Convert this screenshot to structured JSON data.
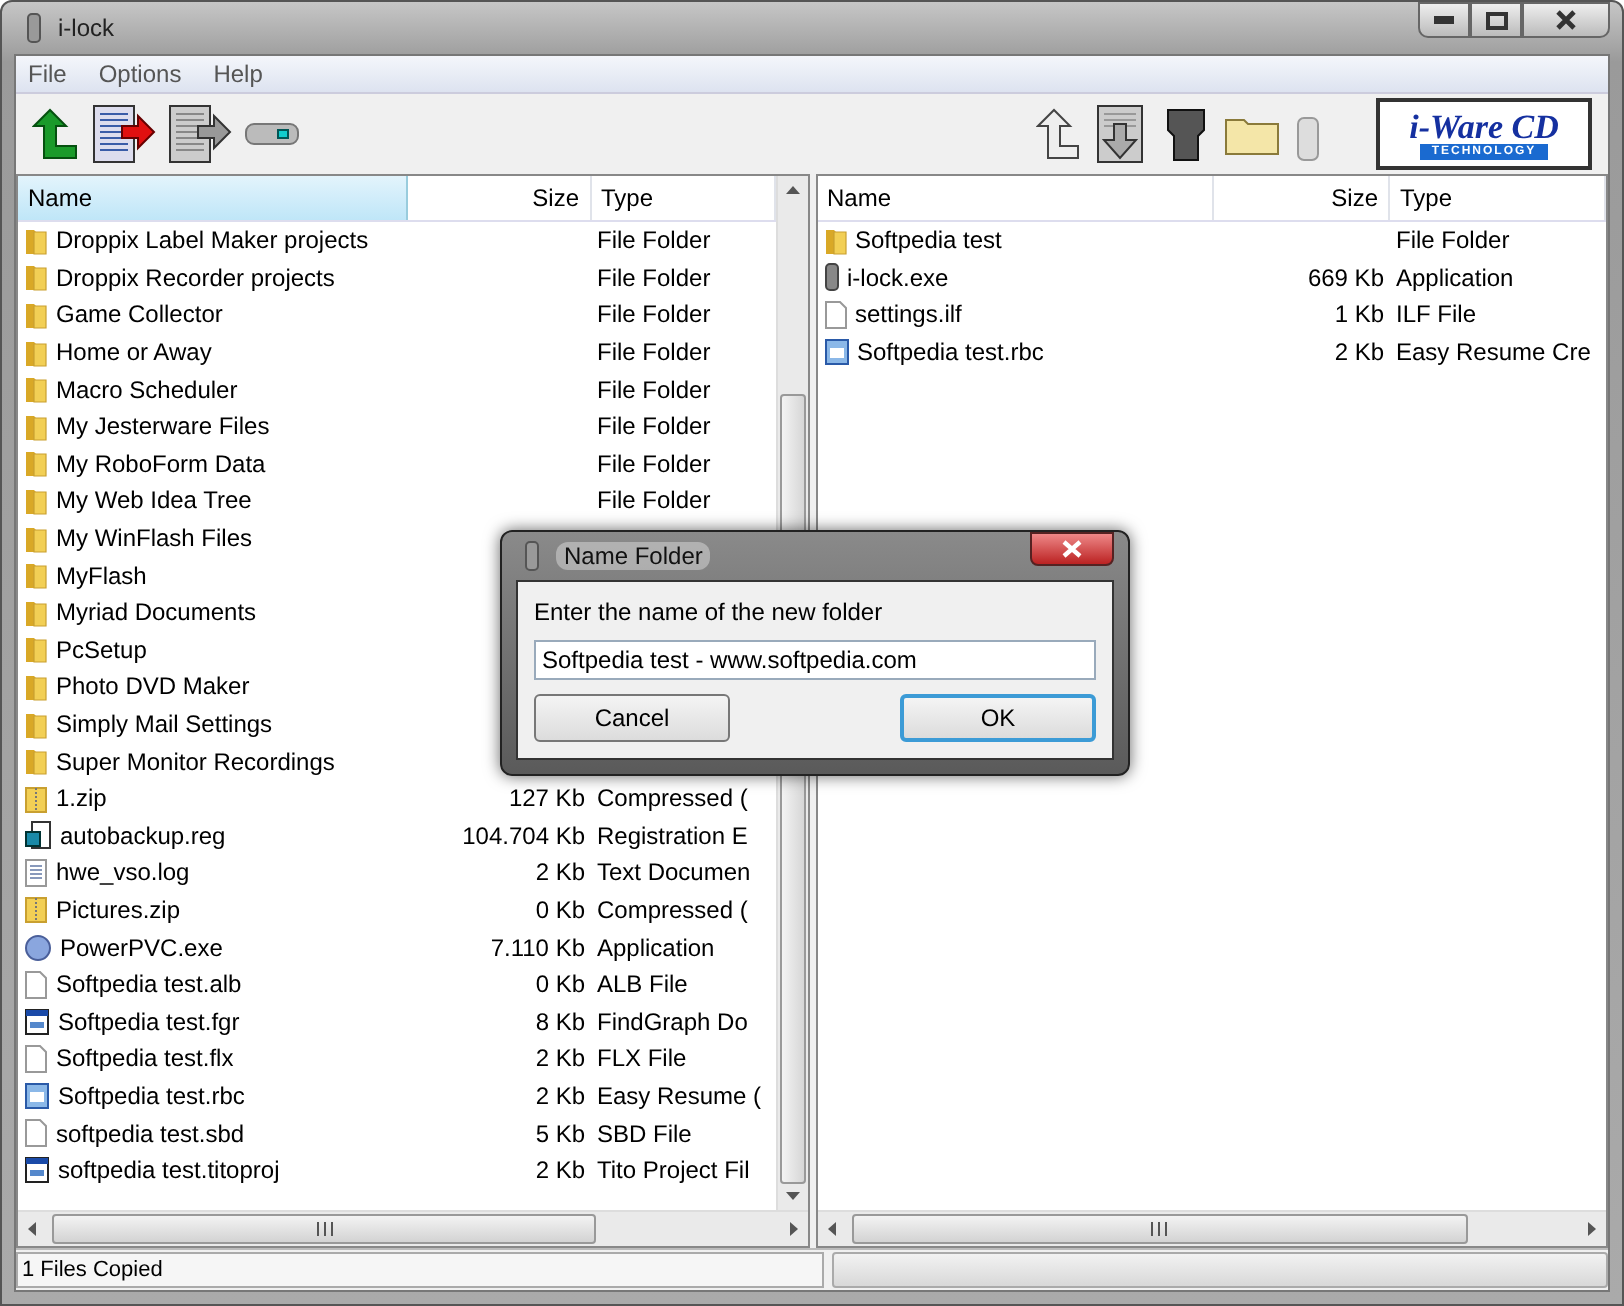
{
  "window": {
    "title": "i-lock"
  },
  "menu": [
    "File",
    "Options",
    "Help"
  ],
  "logo": {
    "title": "i-Ware CD",
    "subtitle": "TECHNOLOGY"
  },
  "left_pane": {
    "columns": [
      {
        "label": "Name",
        "selected": true
      },
      {
        "label": "Size",
        "selected": false
      },
      {
        "label": "Type",
        "selected": false
      }
    ],
    "rows": [
      {
        "kind": "folder",
        "name": "Droppix Label Maker projects",
        "type": "File Folder"
      },
      {
        "kind": "folder",
        "name": "Droppix Recorder projects",
        "type": "File Folder"
      },
      {
        "kind": "folder",
        "name": "Game Collector",
        "type": "File Folder"
      },
      {
        "kind": "folder",
        "name": "Home or Away",
        "type": "File Folder"
      },
      {
        "kind": "folder",
        "name": "Macro Scheduler",
        "type": "File Folder"
      },
      {
        "kind": "folder",
        "name": "My Jesterware Files",
        "type": "File Folder"
      },
      {
        "kind": "folder",
        "name": "My RoboForm Data",
        "type": "File Folder"
      },
      {
        "kind": "folder",
        "name": "My Web Idea Tree",
        "type": "File Folder"
      },
      {
        "kind": "folder",
        "name": "My WinFlash Files"
      },
      {
        "kind": "folder",
        "name": "MyFlash"
      },
      {
        "kind": "folder",
        "name": "Myriad Documents"
      },
      {
        "kind": "folder",
        "name": "PcSetup"
      },
      {
        "kind": "folder",
        "name": "Photo DVD Maker"
      },
      {
        "kind": "folder",
        "name": "Simply Mail Settings"
      },
      {
        "kind": "folder",
        "name": "Super Monitor Recordings"
      },
      {
        "kind": "zip",
        "name": "1.zip",
        "size": "127 Kb",
        "type": "Compressed ("
      },
      {
        "kind": "reg",
        "name": "autobackup.reg",
        "size": "104.704 Kb",
        "type": "Registration E"
      },
      {
        "kind": "text",
        "name": "hwe_vso.log",
        "size": "2 Kb",
        "type": "Text Documen"
      },
      {
        "kind": "zip",
        "name": "Pictures.zip",
        "size": "0 Kb",
        "type": "Compressed ("
      },
      {
        "kind": "app",
        "name": "PowerPVC.exe",
        "size": "7.110 Kb",
        "type": "Application"
      },
      {
        "kind": "blank",
        "name": "Softpedia test.alb",
        "size": "0 Kb",
        "type": "ALB File"
      },
      {
        "kind": "window",
        "name": "Softpedia test.fgr",
        "size": "8 Kb",
        "type": "FindGraph Do"
      },
      {
        "kind": "blank",
        "name": "Softpedia test.flx",
        "size": "2 Kb",
        "type": "FLX File"
      },
      {
        "kind": "resume",
        "name": "Softpedia test.rbc",
        "size": "2 Kb",
        "type": "Easy Resume ("
      },
      {
        "kind": "blank",
        "name": "softpedia test.sbd",
        "size": "5 Kb",
        "type": "SBD File"
      },
      {
        "kind": "window",
        "name": "softpedia test.titoproj",
        "size": "2 Kb",
        "type": "Tito Project Fil"
      }
    ]
  },
  "right_pane": {
    "columns": [
      {
        "label": "Name",
        "selected": false
      },
      {
        "label": "Size",
        "selected": false
      },
      {
        "label": "Type",
        "selected": false
      }
    ],
    "rows": [
      {
        "kind": "folder",
        "name": "Softpedia test",
        "type": "File Folder"
      },
      {
        "kind": "lock",
        "name": "i-lock.exe",
        "size": "669 Kb",
        "type": "Application"
      },
      {
        "kind": "blank",
        "name": "settings.ilf",
        "size": "1 Kb",
        "type": "ILF File"
      },
      {
        "kind": "resume",
        "name": "Softpedia test.rbc",
        "size": "2 Kb",
        "type": "Easy Resume Cre"
      }
    ]
  },
  "status_bar": "1 Files Copied",
  "dialog": {
    "title": "Name Folder",
    "prompt": "Enter the name of the new folder",
    "value": "Softpedia test - www.softpedia.com",
    "buttons": [
      {
        "label": "Cancel",
        "default": false
      },
      {
        "label": "OK",
        "default": true
      }
    ]
  }
}
